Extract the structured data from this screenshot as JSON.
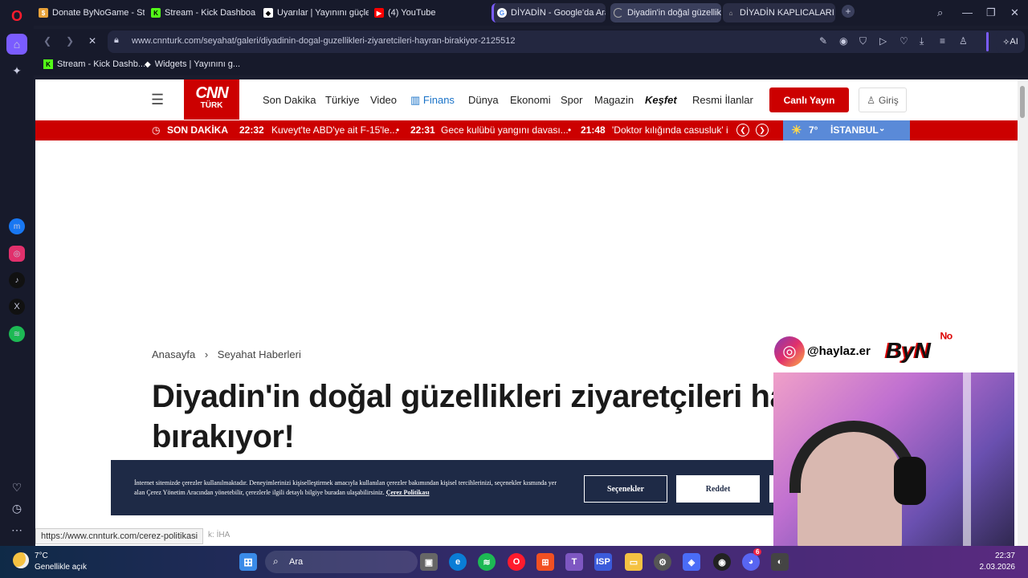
{
  "browser": {
    "tabs": [
      {
        "title": "Donate ByNoGame - Strea",
        "icon_color": "#e8a23a",
        "icon": "coin-icon"
      },
      {
        "title": "Stream - Kick Dashboard",
        "icon_color": "#53fc18",
        "icon": "kick-icon"
      },
      {
        "title": "Uyarılar | Yayınını güçlend",
        "icon_color": "#ffffff",
        "icon": "streamlabs-icon"
      },
      {
        "title": "(4) YouTube",
        "icon_color": "#ff0000",
        "icon": "youtube-icon"
      },
      {
        "title": "DİYADİN - Google'da Ara",
        "icon_color": "#4285f4",
        "icon": "google-icon"
      },
      {
        "title": "Diyadin'in doğal güzellikle",
        "icon_color": "#aaaaaa",
        "icon": "loading-icon"
      },
      {
        "title": "DİYADİN KAPLICALARI | K",
        "icon_color": "#bbbbbb",
        "icon": "site-icon"
      }
    ],
    "url": "www.cnnturk.com/seyahat/galeri/diyadinin-dogal-guzellikleri-ziyaretcileri-hayran-birakiyor-2125512",
    "ai_label": "AI",
    "bookmarks": [
      {
        "label": "Stream - Kick Dashb...",
        "icon": "kick-icon"
      },
      {
        "label": "Widgets | Yayınını g...",
        "icon": "streamlabs-icon"
      }
    ]
  },
  "site": {
    "logo_main": "CNN",
    "logo_sub": "TÜRK",
    "nav": [
      "Son Dakika",
      "Türkiye",
      "Video",
      "Finans",
      "Dünya",
      "Ekonomi",
      "Spor",
      "Magazin",
      "Keşfet",
      "Resmi İlanlar"
    ],
    "live_button": "Canlı Yayın",
    "login_button": "Giriş",
    "breaking_label": "SON DAKİKA",
    "breaking": [
      {
        "time": "22:32",
        "text": "Kuveyt'te ABD'ye ait F-15'le..."
      },
      {
        "time": "22:31",
        "text": "Gece kulübü yangını davası..."
      },
      {
        "time": "21:48",
        "text": "'Doktor kılığında casusluk' i"
      }
    ],
    "weather_temp": "7°",
    "weather_city": "İSTANBUL",
    "breadcrumb": [
      "Anasayfa",
      "Seyahat Haberleri"
    ],
    "headline_line1": "Diyadin'in doğal güzellikleri ziyaretçileri ha",
    "headline_line2": "bırakıyor!",
    "source_label": "k:",
    "source": "İHA",
    "cookie": {
      "text": "İnternet sitemizde çerezler kullanılmaktadır. Deneyimlerinizi kişiselleştirmek amacıyla kullanılan çerezler bakımından kişisel tercihlerinizi, seçenekler kısmında yer alan Çerez Yönetim Aracından yönetebilir, çerezlerle ilgili detaylı bilgiye buradan ulaşabilirsiniz.",
      "link": "Çerez Politikası",
      "options_button": "Seçenekler",
      "reject_button": "Reddet"
    },
    "status_url": "https://www.cnnturk.com/cerez-politikasi"
  },
  "overlay": {
    "instagram_handle": "@haylaz.er",
    "brand": "ByN"
  },
  "taskbar": {
    "weather_temp": "7°C",
    "weather_desc": "Genellikle açık",
    "search_placeholder": "Ara",
    "time": "22:37",
    "date": "2.03.2026",
    "discord_badge": "6"
  },
  "colors": {
    "cnn_red": "#cc0000",
    "finans_blue": "#1a73c8",
    "weather_blue": "#5a8ad8",
    "cookie_bg": "#1e2a46"
  }
}
